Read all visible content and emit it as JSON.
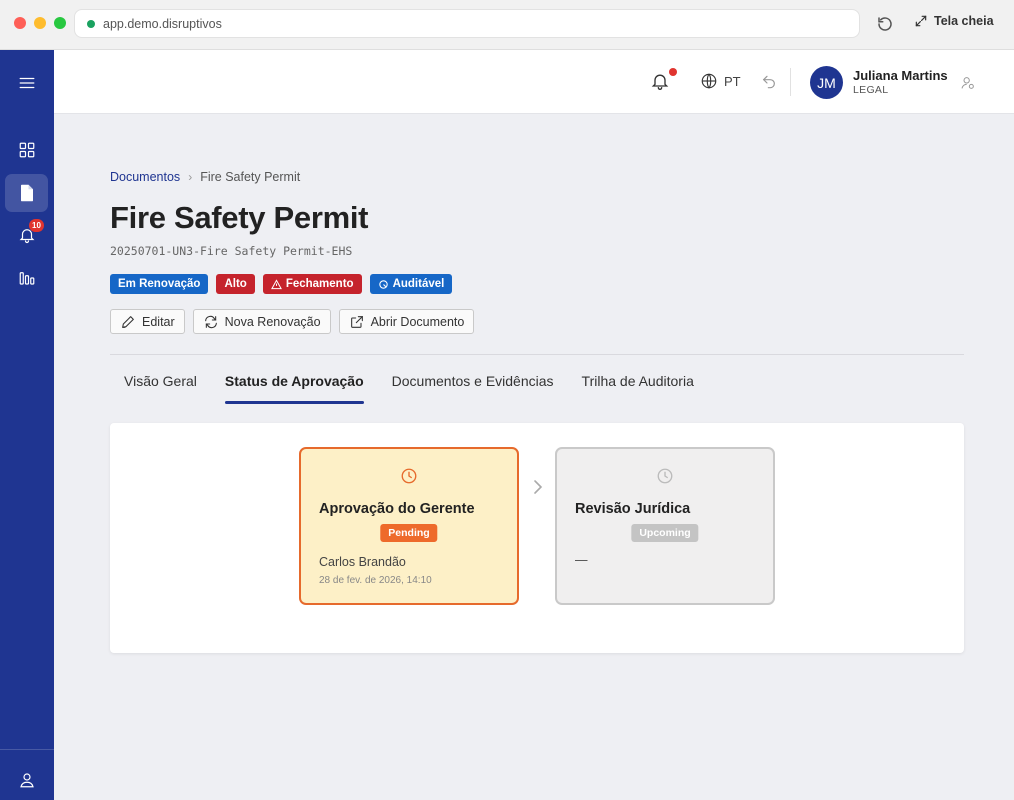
{
  "browser": {
    "url": "app.demo.disruptivos",
    "fullscreen_label": "Tela cheia"
  },
  "sidebar": {
    "notifications_count": "10"
  },
  "topbar": {
    "language": "PT",
    "user": {
      "initials": "JM",
      "name": "Juliana Martins",
      "role": "LEGAL"
    }
  },
  "breadcrumb": {
    "parent": "Documentos",
    "current": "Fire Safety Permit"
  },
  "document": {
    "title": "Fire Safety Permit",
    "code": "20250701-UN3-Fire Safety Permit-EHS"
  },
  "badges": [
    {
      "label": "Em Renovação",
      "color": "#1667c7"
    },
    {
      "label": "Alto",
      "color": "#c5232c"
    },
    {
      "label": "Fechamento",
      "color": "#c5232c",
      "icon": "warning-icon"
    },
    {
      "label": "Auditável",
      "color": "#1667c7",
      "icon": "audit-icon"
    }
  ],
  "actions": {
    "edit": "Editar",
    "renew": "Nova Renovação",
    "open": "Abrir Documento"
  },
  "tabs": [
    {
      "label": "Visão Geral"
    },
    {
      "label": "Status de Aprovação",
      "active": true
    },
    {
      "label": "Documentos e Evidências"
    },
    {
      "label": "Trilha de Auditoria"
    }
  ],
  "approval_steps": [
    {
      "title": "Aprovação do Gerente",
      "status": "Pending",
      "status_color": "#ee6a2b",
      "assignee": "Carlos Brandão",
      "date": "28 de fev. de 2026, 14:10"
    },
    {
      "title": "Revisão Jurídica",
      "status": "Upcoming",
      "status_color": "#c4c4c4",
      "assignee": "—"
    }
  ]
}
